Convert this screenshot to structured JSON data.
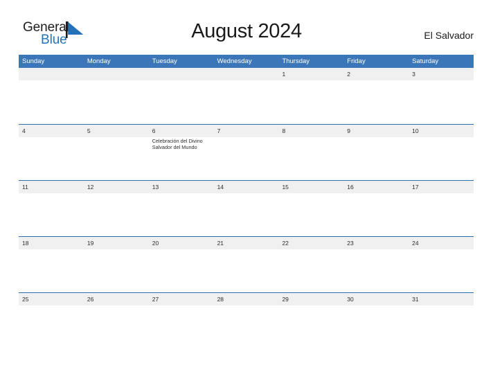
{
  "brand": {
    "name_part1": "General",
    "name_part2": "Blue",
    "accent_color": "#2572b8"
  },
  "header": {
    "title": "August 2024",
    "country": "El Salvador"
  },
  "theme": {
    "header_blue": "#3b76b8",
    "row_border_blue": "#2e6cab",
    "band_gray": "#f0f0f0",
    "text_dark": "#2b2b2b"
  },
  "calendar": {
    "weekdays": [
      "Sunday",
      "Monday",
      "Tuesday",
      "Wednesday",
      "Thursday",
      "Friday",
      "Saturday"
    ],
    "weeks": [
      [
        {
          "date": "",
          "events": []
        },
        {
          "date": "",
          "events": []
        },
        {
          "date": "",
          "events": []
        },
        {
          "date": "",
          "events": []
        },
        {
          "date": "1",
          "events": []
        },
        {
          "date": "2",
          "events": []
        },
        {
          "date": "3",
          "events": []
        }
      ],
      [
        {
          "date": "4",
          "events": []
        },
        {
          "date": "5",
          "events": []
        },
        {
          "date": "6",
          "events": [
            "Celebración del Divino Salvador del Mundo"
          ]
        },
        {
          "date": "7",
          "events": []
        },
        {
          "date": "8",
          "events": []
        },
        {
          "date": "9",
          "events": []
        },
        {
          "date": "10",
          "events": []
        }
      ],
      [
        {
          "date": "11",
          "events": []
        },
        {
          "date": "12",
          "events": []
        },
        {
          "date": "13",
          "events": []
        },
        {
          "date": "14",
          "events": []
        },
        {
          "date": "15",
          "events": []
        },
        {
          "date": "16",
          "events": []
        },
        {
          "date": "17",
          "events": []
        }
      ],
      [
        {
          "date": "18",
          "events": []
        },
        {
          "date": "19",
          "events": []
        },
        {
          "date": "20",
          "events": []
        },
        {
          "date": "21",
          "events": []
        },
        {
          "date": "22",
          "events": []
        },
        {
          "date": "23",
          "events": []
        },
        {
          "date": "24",
          "events": []
        }
      ],
      [
        {
          "date": "25",
          "events": []
        },
        {
          "date": "26",
          "events": []
        },
        {
          "date": "27",
          "events": []
        },
        {
          "date": "28",
          "events": []
        },
        {
          "date": "29",
          "events": []
        },
        {
          "date": "30",
          "events": []
        },
        {
          "date": "31",
          "events": []
        }
      ]
    ]
  }
}
